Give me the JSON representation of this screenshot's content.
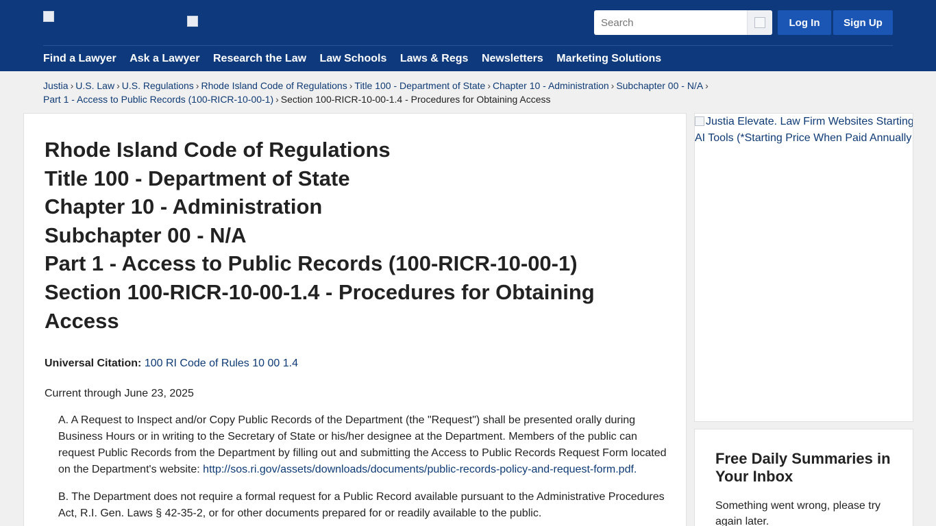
{
  "header": {
    "search_placeholder": "Search",
    "login_label": "Log In",
    "signup_label": "Sign Up",
    "nav": [
      "Find a Lawyer",
      "Ask a Lawyer",
      "Research the Law",
      "Law Schools",
      "Laws & Regs",
      "Newsletters",
      "Marketing Solutions"
    ]
  },
  "breadcrumb": {
    "items": [
      "Justia",
      "U.S. Law",
      "U.S. Regulations",
      "Rhode Island Code of Regulations",
      "Title 100 - Department of State",
      "Chapter 10 - Administration",
      "Subchapter 00 - N/A",
      "Part 1 - Access to Public Records (100-RICR-10-00-1)"
    ],
    "current": "Section 100-RICR-10-00-1.4 - Procedures for Obtaining Access",
    "separator": "›"
  },
  "main": {
    "title_lines": [
      "Rhode Island Code of Regulations",
      "Title 100 - Department of State",
      "Chapter 10 - Administration",
      "Subchapter 00 - N/A",
      "Part 1 - Access to Public Records (100-RICR-10-00-1)",
      "Section 100-RICR-10-00-1.4 - Procedures for Obtaining Access"
    ],
    "citation_label": "Universal Citation:",
    "citation_link": "100 RI Code of Rules 10 00 1.4",
    "current_through": "Current through June 23, 2025",
    "para_a_text": "A. A Request to Inspect and/or Copy Public Records of the Department (the \"Request\") shall be presented orally during Business Hours or in writing to the Secretary of State or his/her designee at the Department. Members of the public can request Public Records from the Department by filling out and submitting the Access to Public Records Request Form located on the Department's website: ",
    "para_a_link": "http://sos.ri.gov/assets/downloads/documents/public-records-policy-and-request-form.pdf.",
    "para_b_text": "B. The Department does not require a formal request for a Public Record available pursuant to the Administrative Procedures Act, R.I. Gen. Laws § 42-35-2, or for other documents prepared for or readily available to the public."
  },
  "sidebar": {
    "ad_alt": "Justia Elevate. Law Firm Websites Starting AI Tools (*Starting Price When Paid Annually",
    "newsletter_title": "Free Daily Summaries in Your Inbox",
    "newsletter_msg": "Something went wrong, please try again later."
  },
  "colors": {
    "header_bg": "#0e3a7d",
    "button_bg": "#1c56b5",
    "link": "#0e3a75"
  },
  "icons": {
    "search": "broken-image-icon"
  }
}
